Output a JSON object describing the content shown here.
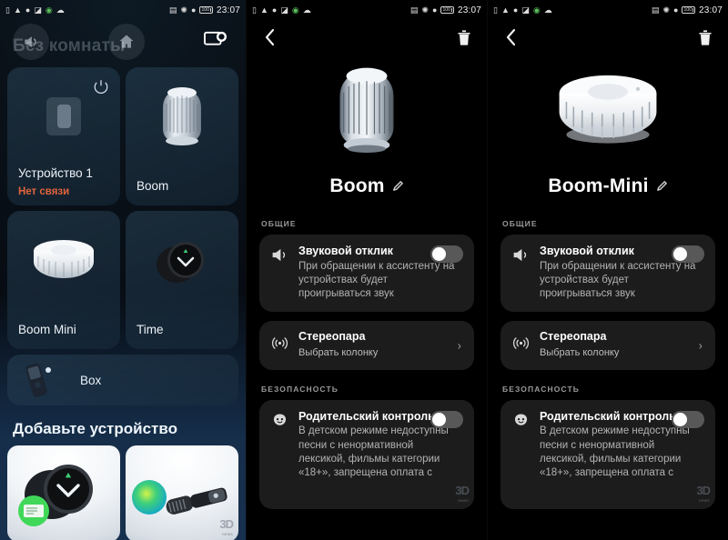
{
  "statusbar": {
    "left_icons": [
      "vibrate-icon",
      "wifi-icon",
      "location-icon",
      "nfc-icon",
      "sync-icon",
      "cloud-icon"
    ],
    "right_icons": [
      "sim-icon",
      "bluetooth-icon",
      "location-icon"
    ],
    "battery": "100",
    "time": "23:07"
  },
  "left": {
    "room_title": "Без комнаты",
    "chip_icons": [
      "speaker-chip-icon",
      "home-chip-icon"
    ],
    "header_right_icon": "cast-device-icon",
    "devices": [
      {
        "name": "Устройство 1",
        "status": "Нет связи",
        "art": "light-switch",
        "power": true
      },
      {
        "name": "Boom",
        "status": "",
        "art": "boom-speaker",
        "power": false
      },
      {
        "name": "Boom Mini",
        "status": "",
        "art": "boom-mini-speaker",
        "power": false
      },
      {
        "name": "Time",
        "status": "",
        "art": "time-clock",
        "power": false
      }
    ],
    "wide_device": {
      "name": "Box",
      "art": "box-remote"
    },
    "add_title": "Добавьте устройство",
    "promos": [
      {
        "art": "time-clock-promo"
      },
      {
        "art": "mic-promo"
      }
    ]
  },
  "watermark": {
    "brand": "3D",
    "sub": "news"
  },
  "detail_common": {
    "back_icon": "chevron-left-icon",
    "delete_icon": "trash-icon",
    "edit_icon": "pencil-icon",
    "sections": {
      "general": "ОБЩИЕ",
      "security": "БЕЗОПАСНОСТЬ"
    },
    "sound_feedback": {
      "icon": "speaker-icon",
      "title": "Звуковой отклик",
      "desc": "При обращении к ассистенту на устройствах будет проигрываться звук",
      "toggle": "off"
    },
    "stereo_pair": {
      "icon": "stereo-waves-icon",
      "title": "Стереопара",
      "desc": "Выбрать колонку",
      "chevron": "›"
    },
    "parental_control": {
      "icon": "child-face-icon",
      "title": "Родительский контроль",
      "desc": "В детском режиме недоступны песни с ненормативной лексикой, фильмы категории «18+», запрещена оплата с",
      "toggle": "off"
    }
  },
  "detail_mid": {
    "device_name": "Boom",
    "hero_art": "boom-speaker"
  },
  "detail_right": {
    "device_name": "Boom-Mini",
    "hero_art": "boom-mini-speaker"
  },
  "colors": {
    "accent_error": "#e2643c",
    "card_bg": "#1c1c1c",
    "toggle_track": "#585858",
    "toggle_knob": "#ffffff"
  }
}
